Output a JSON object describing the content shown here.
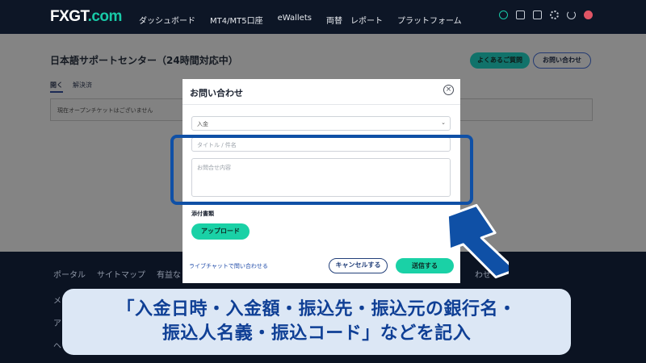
{
  "brand": {
    "logo_main": "FXGT",
    "logo_suffix": ".com",
    "accent": "#18c9a7"
  },
  "nav": {
    "items": [
      "ダッシュボード",
      "MT4/MT5口座",
      "eWallets",
      "両替",
      "レポート",
      "プラットフォーム"
    ]
  },
  "header_icons": [
    "check-circle-icon",
    "mail-icon",
    "card-icon",
    "gear-icon",
    "power-icon",
    "flag-icon"
  ],
  "page": {
    "title": "日本語サポートセンター（24時間対応中）",
    "faq_button": "よくあるご質問",
    "contact_button": "お問い合わせ",
    "tabs": [
      "開く",
      "解決済"
    ],
    "no_tickets": "現在オープンチケットはございません"
  },
  "footer": {
    "links": [
      "ポータル",
      "サイトマップ",
      "有益なリ"
    ],
    "right_text": "わせ",
    "side_marks": [
      "メ",
      "ア",
      "ヘ"
    ]
  },
  "modal": {
    "title": "お問い合わせ",
    "select_value": "入金",
    "title_placeholder": "タイトル / 件名",
    "body_placeholder": "お問合せ内容",
    "attach_label": "添付書類",
    "upload_button": "アップロード",
    "live_chat_link": "ライブチャットで問い合わせる",
    "cancel_button": "キャンセルする",
    "send_button": "送信する"
  },
  "annotation": {
    "line1": "「入金日時・入金額・振込先・振込元の銀行名・",
    "line2": "振込人名義・振込コード」などを記入",
    "highlight_color": "#0f50a6"
  }
}
